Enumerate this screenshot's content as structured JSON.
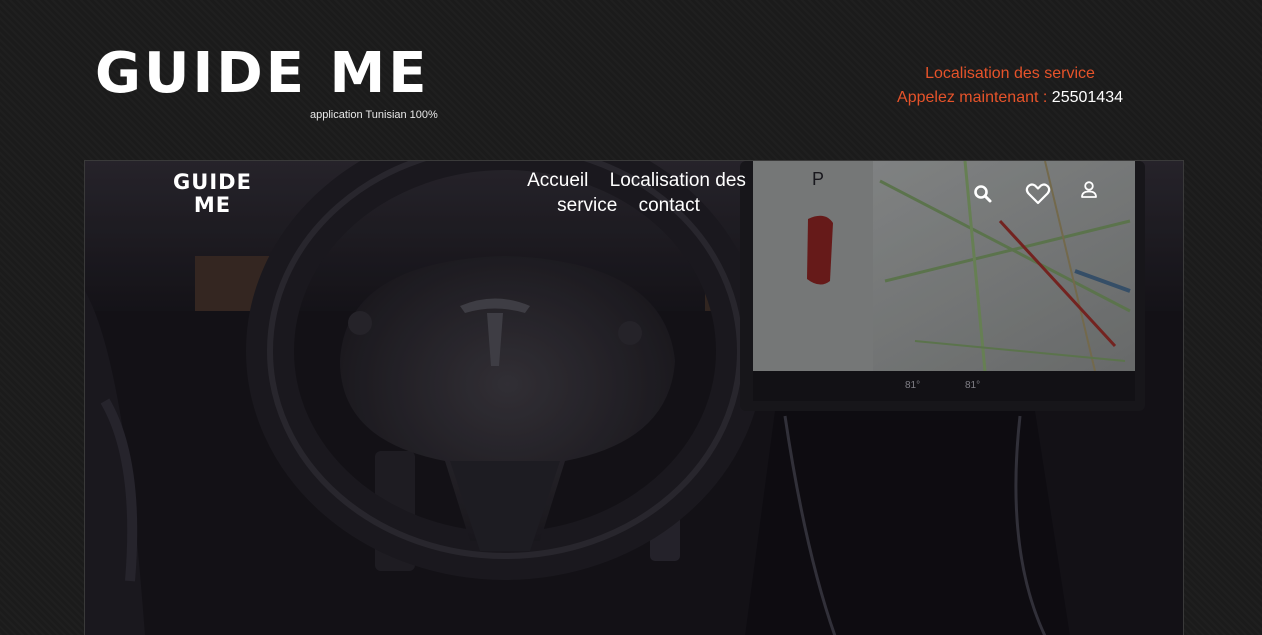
{
  "header": {
    "brand_title": "GUIDE ME",
    "tagline": "application Tunisian 100%",
    "contact_line1": "Localisation des service",
    "contact_line2_label": "Appelez maintenant :",
    "phone": "25501434"
  },
  "navbar": {
    "logo_line1": "GUIDE",
    "logo_line2": "ME",
    "links": [
      "Accueil",
      "Localisation des service",
      "contact"
    ],
    "icons": [
      "search-icon",
      "heart-icon",
      "user-icon"
    ]
  },
  "hero": {
    "display": {
      "gear": "P",
      "temp_left": "81°",
      "temp_right": "81°"
    }
  },
  "colors": {
    "accent": "#e6532a",
    "background": "#1b1b1b",
    "text": "#ffffff"
  }
}
